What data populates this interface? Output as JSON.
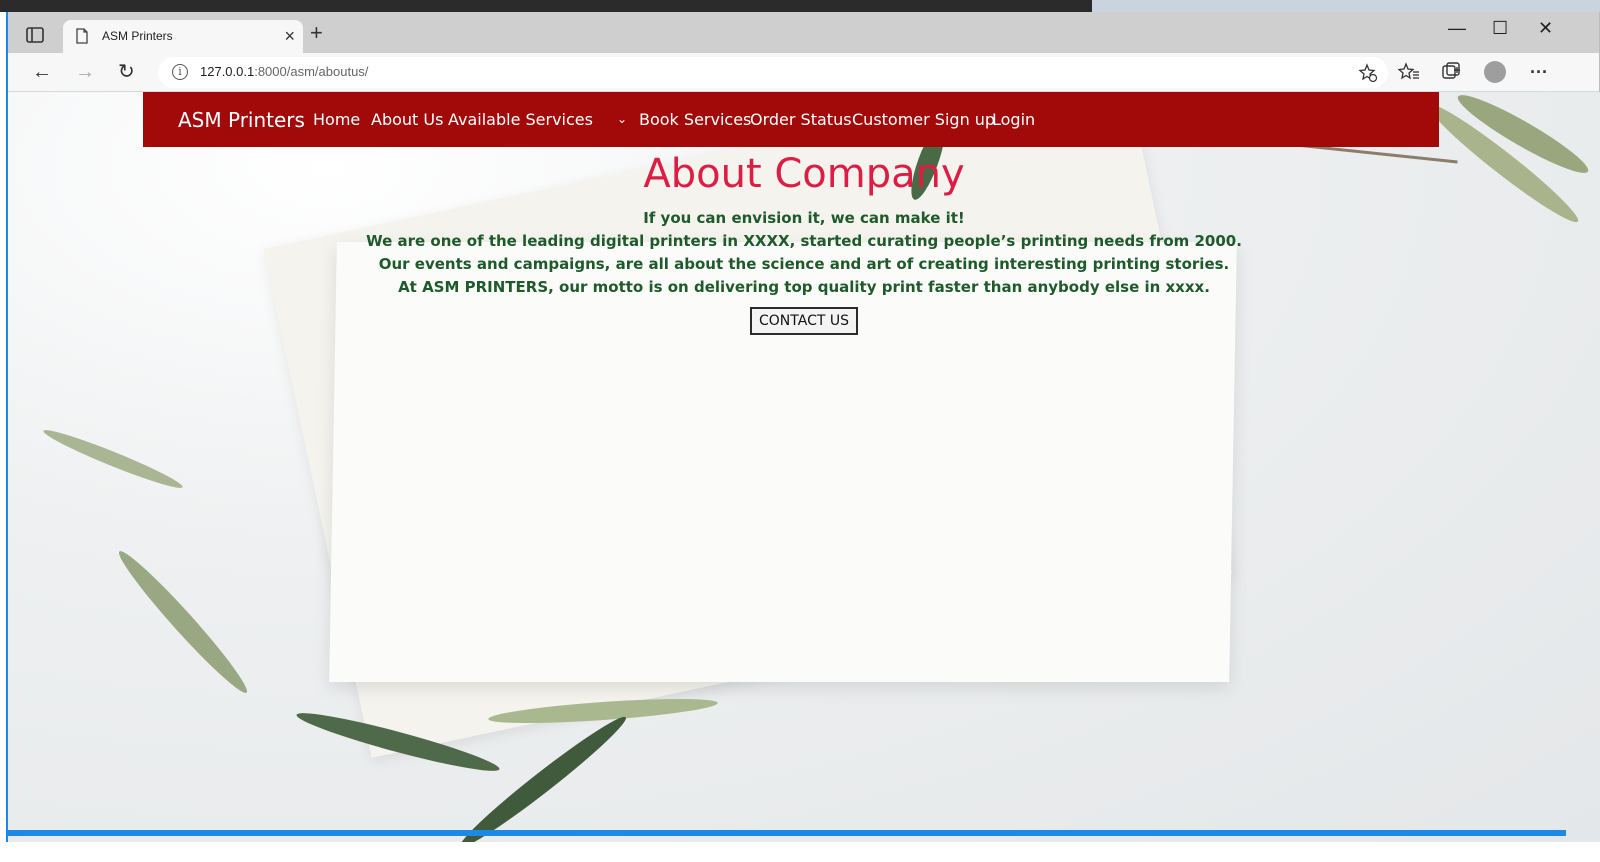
{
  "browser": {
    "tab_title": "ASM Printers",
    "url_host": "127.0.0.1",
    "url_rest": ":8000/asm/aboutus/",
    "close_tab_glyph": "×",
    "new_tab_glyph": "+",
    "minimize_glyph": "—",
    "maximize_glyph": "☐",
    "close_window_glyph": "✕",
    "back_glyph": "←",
    "forward_glyph": "→",
    "reload_glyph": "↻",
    "info_glyph": "i",
    "more_glyph": "···",
    "icons": [
      "tab-actions-icon",
      "page-icon",
      "info-icon",
      "add-favorite-icon",
      "favorites-icon",
      "collections-icon",
      "profile-icon",
      "more-icon"
    ]
  },
  "site": {
    "brand": "ASM Printers",
    "nav": {
      "home": "Home",
      "about": "About Us",
      "services": "Available Services",
      "book": "Book Services",
      "status": "Order Status",
      "signup": "Customer Sign up",
      "login": "Login"
    },
    "caret_glyph": "⌄",
    "accent_color": "#a20a0a",
    "heading_color": "#dc1e44",
    "text_color": "#1f5a2b"
  },
  "main": {
    "heading": "About Company",
    "lines": [
      "If you can envision it, we can make it!",
      "We are one of the leading digital printers in XXXX, started curating people’s printing needs from 2000.",
      "Our events and campaigns, are all about the science and art of creating interesting printing stories.",
      "At ASM PRINTERS, our motto is on delivering top quality print faster than anybody else in xxxx."
    ],
    "contact_button": "CONTACT US"
  }
}
